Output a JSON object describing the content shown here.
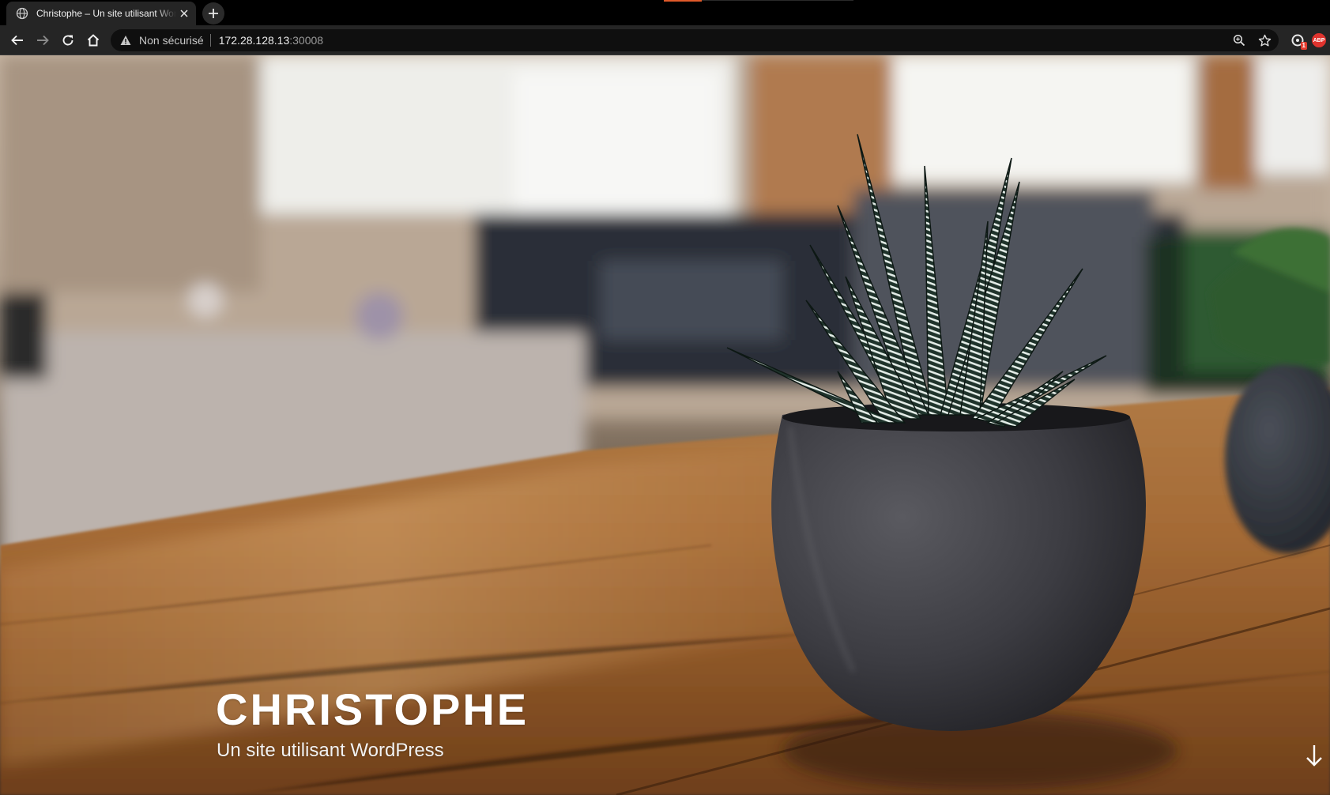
{
  "browser": {
    "tab": {
      "title": "Christophe – Un site utilisant WordPress",
      "favicon": "globe-icon"
    },
    "address_bar": {
      "security_label": "Non sécurisé",
      "host": "172.28.128.13",
      "port": ":30008"
    },
    "toolbar_icons": [
      "back-icon",
      "forward-icon",
      "reload-icon",
      "home-icon",
      "zoom-icon",
      "star-icon"
    ],
    "extensions": [
      {
        "name": "extension-icon",
        "badge": "1"
      },
      {
        "name": "adblock-icon",
        "label": "ABP"
      }
    ]
  },
  "page": {
    "site_title": "CHRISTOPHE",
    "site_description": "Un site utilisant WordPress",
    "scroll_icon": "arrow-down-icon"
  },
  "colors": {
    "chrome_bg": "#252525",
    "tabbar_bg": "#000000",
    "omnibox_bg": "#0f0f0f",
    "title_text": "#ffffff"
  }
}
